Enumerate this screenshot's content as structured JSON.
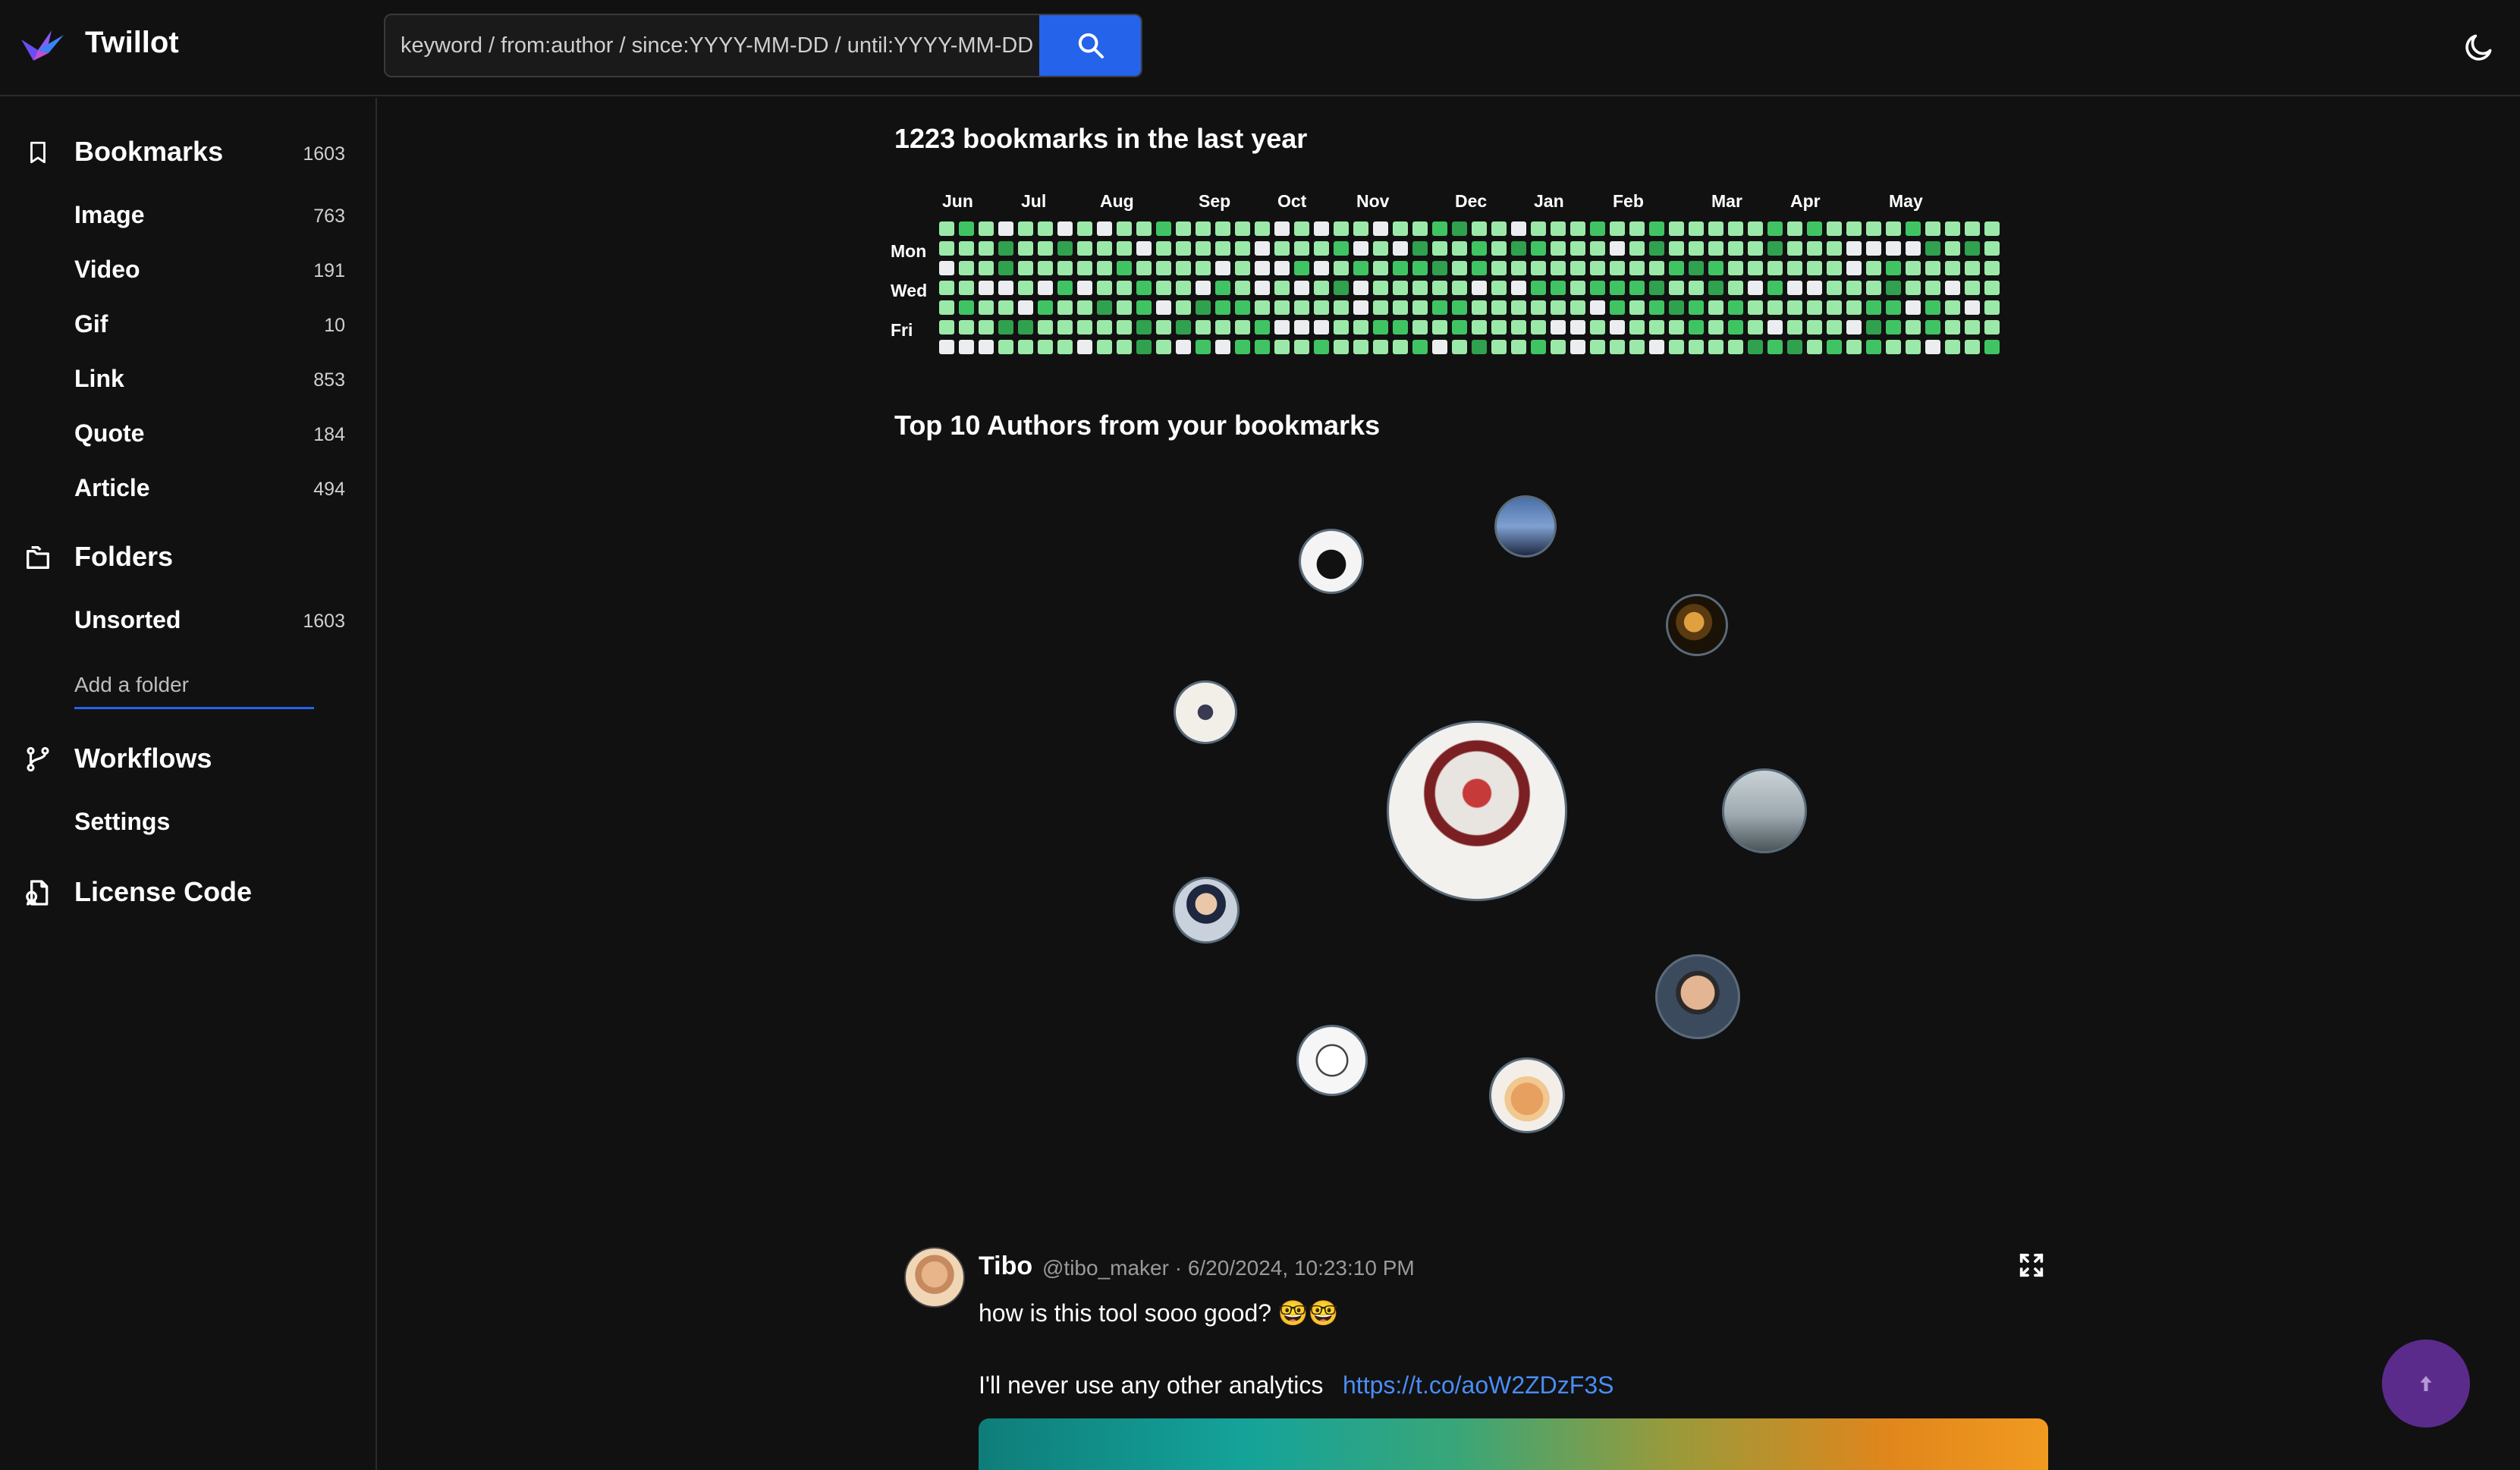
{
  "app": {
    "name": "Twillot"
  },
  "search": {
    "placeholder": "keyword / from:author / since:YYYY-MM-DD / until:YYYY-MM-DD"
  },
  "sidebar": {
    "bookmarks": {
      "label": "Bookmarks",
      "count": "1603"
    },
    "filters": [
      {
        "label": "Image",
        "count": "763"
      },
      {
        "label": "Video",
        "count": "191"
      },
      {
        "label": "Gif",
        "count": "10"
      },
      {
        "label": "Link",
        "count": "853"
      },
      {
        "label": "Quote",
        "count": "184"
      },
      {
        "label": "Article",
        "count": "494"
      }
    ],
    "folders": {
      "label": "Folders",
      "items": [
        {
          "label": "Unsorted",
          "count": "1603"
        }
      ],
      "add_placeholder": "Add a folder"
    },
    "workflows": {
      "label": "Workflows",
      "items": [
        {
          "label": "Settings"
        }
      ]
    },
    "license": {
      "label": "License Code"
    }
  },
  "main": {
    "heatmap_title": "1223 bookmarks in the last year",
    "months": [
      "Jun",
      "Jul",
      "Aug",
      "Sep",
      "Oct",
      "Nov",
      "Dec",
      "Jan",
      "Feb",
      "Mar",
      "Apr",
      "May"
    ],
    "days": [
      "Mon",
      "Wed",
      "Fri"
    ],
    "top_authors_title": "Top 10 Authors from your bookmarks"
  },
  "tweet": {
    "author_name": "Tibo",
    "meta": "@tibo_maker · 6/20/2024, 10:23:10 PM",
    "text_line1": "how is this tool sooo good? 🤓🤓",
    "text_line2": "I'll never use any other analytics",
    "link": "https://t.co/aoW2ZDzF3S"
  },
  "colors": {
    "accent": "#2563eb",
    "heat_empty": "#ebedf0",
    "heat_light": "#9be9a8",
    "heat_mid": "#40c463",
    "heat_dark": "#30a14e",
    "scroll_top": "#5b2b8c"
  },
  "icons": {
    "logo": "bird-logo-icon",
    "search": "search-icon",
    "theme": "moon-icon",
    "bookmarks": "bookmark-icon",
    "folders": "folders-icon",
    "workflows": "branch-icon",
    "license": "license-icon",
    "expand": "expand-icon",
    "scroll_top": "arrow-up-icon"
  }
}
